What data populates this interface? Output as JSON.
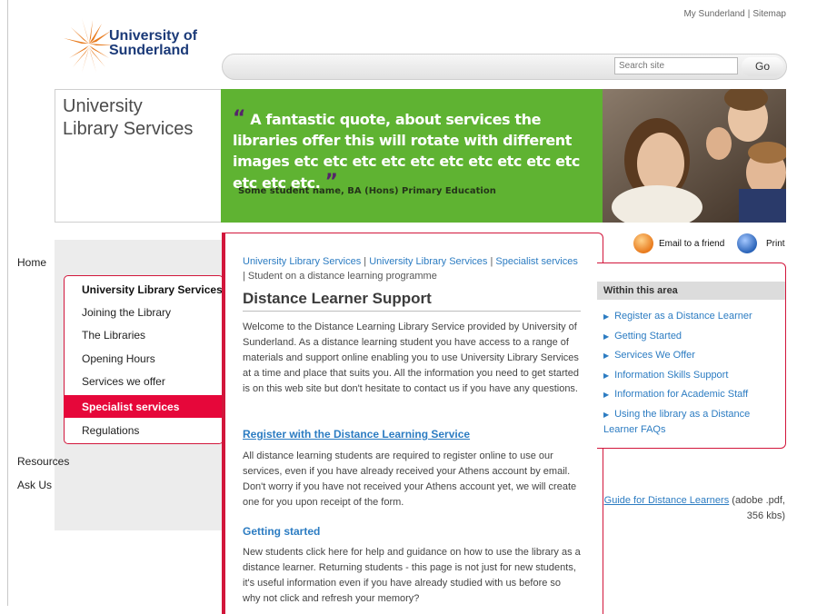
{
  "top_links": {
    "my_sunderland": "My Sunderland",
    "separator": "|",
    "sitemap": "Sitemap"
  },
  "logo": {
    "line1": "University of",
    "line2": "Sunderland",
    "brand_color": "#1b3a78",
    "mark_color": "#e87a1c"
  },
  "search": {
    "placeholder": "Search site",
    "button": "Go"
  },
  "banner": {
    "title_line1": "University",
    "title_line2": "Library Services",
    "quote": "A fantastic quote, about services the libraries offer this will rotate with different images etc etc etc etc etc etc etc etc etc etc etc etc etc.",
    "quote_open": "“",
    "quote_close": "”",
    "author": "Some student name, BA (Hons) Primary Education",
    "quote_bg": "#5fb332"
  },
  "leftnav": {
    "home": "Home",
    "sub_heading": "University Library Services",
    "sub_items": [
      "Joining the Library",
      "The Libraries",
      "Opening Hours",
      "Services we offer"
    ],
    "active": "Specialist services",
    "regulations": "Regulations",
    "resources": "Resources",
    "ask_us": "Ask Us",
    "accent": "#e6073a"
  },
  "breadcrumb": {
    "link1": "University Library Services",
    "link2": "University Library Services",
    "link3": "Specialist services",
    "sep": " | ",
    "current": "Student on a distance learning programme"
  },
  "main": {
    "title": "Distance Learner Support",
    "intro": "Welcome to the Distance Learning Library Service provided by University of Sunderland. As a distance learning student you have access to a range of materials and support online enabling you to use University Library Services at a time and place that suits you. All the information you need to get started is on this web site but don't hesitate to contact us if you have any questions.",
    "register_link": "Register with the Distance Learning Service",
    "register_text": "All distance learning students are required to register online to use our services, even if you have already received your Athens account by email. Don't worry if you have not received your Athens account yet, we will create one for you upon receipt of the form.",
    "getting_started_head": "Getting started",
    "getting_started_text": "New students click here for help and guidance on how to use the library as a distance learner. Returning students - this page is not just for new students, it's useful information even if you have already studied with us before so why not click and refresh your memory?"
  },
  "actions": {
    "email": "Email to a friend",
    "print": "Print"
  },
  "within": {
    "title": "Within this area",
    "links": [
      "Register as a Distance Learner",
      "Getting Started",
      "Services We Offer",
      "Information Skills Support",
      "Information for Academic Staff",
      "Using the library as a Distance Learner FAQs"
    ],
    "bullet": "▶"
  },
  "guide": {
    "link": "Guide for Distance Learners",
    "meta": " (adobe .pdf, 356 kbs)"
  }
}
